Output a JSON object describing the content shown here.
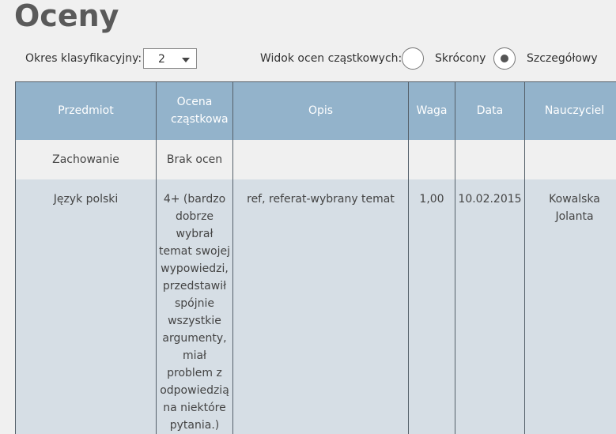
{
  "page": {
    "title": "Oceny"
  },
  "filters": {
    "period_label": "Okres klasyfikacyjny:",
    "period_value": "2",
    "view_label": "Widok ocen cząstkowych:",
    "view_options": [
      {
        "label": "Skrócony",
        "selected": false
      },
      {
        "label": "Szczegółowy",
        "selected": true
      }
    ]
  },
  "table": {
    "headers": [
      "Przedmiot",
      "Ocena cząstkowa",
      "Opis",
      "Waga",
      "Data",
      "Nauczyciel"
    ],
    "rows": [
      {
        "subject": "Zachowanie",
        "grade": "Brak ocen",
        "description": "",
        "weight": "",
        "date": "",
        "teacher": ""
      },
      {
        "subject": "Język polski",
        "grade": "4+ (bardzo dobrze wybrał temat swojej wypowiedzi, przedstawił spójnie wszystkie argumenty, miał problem z odpowiedzią na niektóre pytania.)",
        "description": "ref, referat-wybrany temat",
        "weight": "1,00",
        "date": "10.02.2015",
        "teacher": "Kowalska Jolanta"
      }
    ]
  },
  "colors": {
    "header_bg": "#93b3cb",
    "row_alt_bg": "#d6dee5",
    "grade_text": "#6cc24a"
  }
}
